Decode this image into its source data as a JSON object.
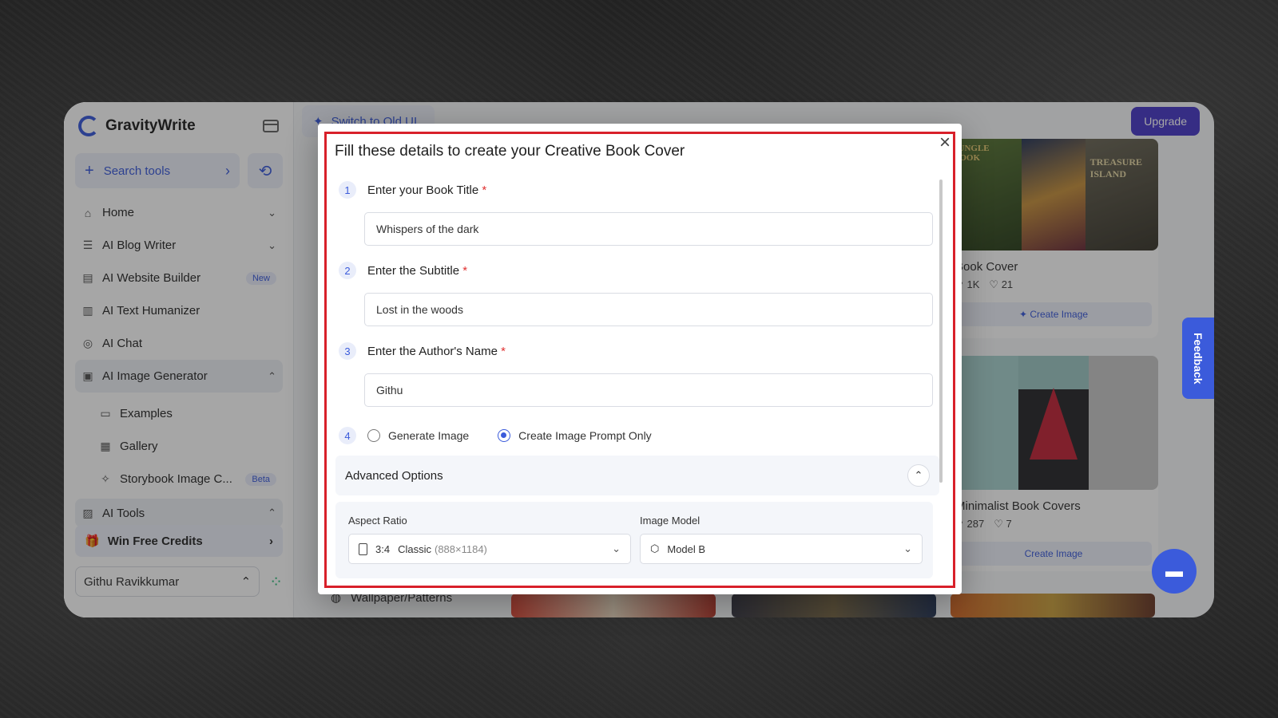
{
  "app": {
    "brand": "GravityWrite",
    "switch_old_ui": "Switch to Old UI",
    "upgrade": "Upgrade"
  },
  "sidebar": {
    "search_label": "Search tools",
    "nav": [
      {
        "label": "Home"
      },
      {
        "label": "AI Blog Writer"
      },
      {
        "label": "AI Website Builder",
        "badge": "New"
      },
      {
        "label": "AI Text Humanizer"
      },
      {
        "label": "AI Chat"
      },
      {
        "label": "AI Image Generator"
      }
    ],
    "sub": [
      {
        "label": "Examples"
      },
      {
        "label": "Gallery"
      },
      {
        "label": "Storybook Image C...",
        "badge": "Beta"
      }
    ],
    "ai_tools": "AI Tools",
    "win_credits": "Win Free Credits",
    "user": "Githu Ravikkumar"
  },
  "cards": [
    {
      "title": "Book Cover",
      "uses": "1K",
      "likes": "21",
      "button": "Create Image",
      "thumbs": [
        "JUNGLE BOOK",
        "",
        "TREASURE ISLAND"
      ]
    },
    {
      "title": "Minimalist Book Covers",
      "uses": "287",
      "likes": "7",
      "button": "Create Image"
    }
  ],
  "feedback": "Feedback",
  "wallpaper": "Wallpaper/Patterns",
  "modal": {
    "title": "Fill these details to create your Creative Book Cover",
    "steps": [
      {
        "num": "1",
        "label": "Enter your Book Title",
        "value": "Whispers of the dark"
      },
      {
        "num": "2",
        "label": "Enter the Subtitle",
        "value": "Lost in the woods"
      },
      {
        "num": "3",
        "label": "Enter the Author's Name",
        "value": "Githu"
      }
    ],
    "step4_num": "4",
    "radio_generate": "Generate Image",
    "radio_prompt": "Create Image Prompt Only",
    "required_mark": "*",
    "advanced": "Advanced Options",
    "aspect_label": "Aspect Ratio",
    "aspect_ratio": "3:4",
    "aspect_name": "Classic",
    "aspect_size": "(888×1184)",
    "model_label": "Image Model",
    "model_value": "Model B"
  },
  "colors": {
    "accent": "#3b5bdb",
    "highlight": "#d8202a",
    "upgrade": "#4b3cc9"
  }
}
